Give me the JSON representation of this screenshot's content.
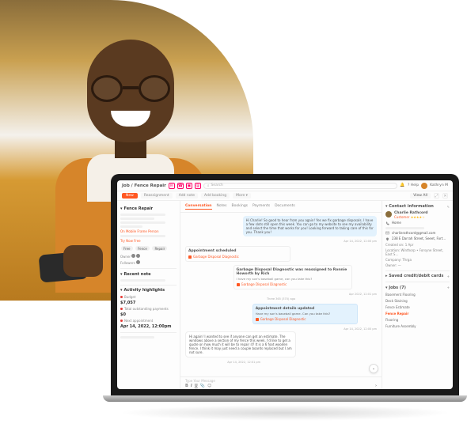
{
  "breadcrumb": "Job / Fence Repair",
  "search_placeholder": "Search",
  "help_label": "Help",
  "user_name": "Kathryn M",
  "actions": {
    "new": "New",
    "reassign": "Reassignment",
    "add_note": "Add note",
    "add_booking": "Add booking",
    "more": "More",
    "view_all": "View All"
  },
  "left": {
    "job_title": "Fence Repair",
    "owner_link": "On Mobile Frame Person",
    "cal_link": "Try Now Free",
    "pills": [
      "Free",
      "Fence",
      "Repair"
    ],
    "notes_title": "Recent note",
    "highlights_title": "Activity highlights",
    "budget_label": "Budget",
    "budget_value": "$7,057",
    "outstanding_label": "Total outstanding payments",
    "outstanding_value": "$0",
    "appt_label": "Next appointment",
    "appt_value": "Apr 14, 2022, 12:00pm"
  },
  "tabs": [
    "Conversation",
    "Notes",
    "Bookings",
    "Payments",
    "Documents"
  ],
  "active_tab": 0,
  "chat": {
    "msg1": "Hi Charlie! So good to hear from you again! Yes we fix garbage disposals. I have a few slots still open this week. You can go to my website to see my availability and select the time that works for you! Looking forward to taking care of this for you. Thank you!",
    "ts1": "Apr 14, 2022, 12:00 pm",
    "card1_title": "Appointment scheduled",
    "card1_link": "Garbage Disposal Diagnostic",
    "card2_title": "Garbage Disposal Diagnostic was reassigned to Ronnie Howorth by Rich",
    "card2_sub": "I have my son's baseball game, can you take this?",
    "card2_link": "Garbage Disposal Diagnostic",
    "ts2": "Apr 2022, 12:01 pm",
    "days_ago": "Three 365 (370) ago",
    "card3_title": "Appointment details updated",
    "card3_sub": "Have my son's baseball game. Can you take this?",
    "card3_link": "Garbage Disposal Diagnostic",
    "ts3": "Apr 14, 2022, 12:00 pm",
    "msg2": "Hi again! I wanted to see if anyone can get an estimate. The windows above a section of my fence this week. I'd like to get a quote on how much it will be to repair it? It is a 6 foot wooden fence. I think it may just need a couple boards replaced but I am not sure.",
    "ts4": "Apr 14, 2022, 12:01 pm",
    "compose_hint": "Type Your Message"
  },
  "right": {
    "title": "Contact information",
    "name": "Charlie Rathcord",
    "role": "Customer",
    "phone_label": "Home",
    "email": "charlierathcord@gmail.com",
    "address": "238 E Darrah Street, Seeet, Fort…",
    "created_label": "Created on",
    "created_val": "1 Apr",
    "location_label": "Location",
    "location_val": "Winthorp • Forsyne Street, East S…",
    "company_label": "Company",
    "company_val": "Thrga",
    "owner_label": "Owner",
    "owner_val": "—",
    "saved_label": "Saved credit/debit cards",
    "jobs_title": "Jobs (7)",
    "jobs": [
      "Basement Flooring",
      "Deck Staining",
      "Fence Estimate",
      "Fence Repair",
      "Flooring",
      "Furniture Assembly"
    ],
    "selected_job": 3
  }
}
